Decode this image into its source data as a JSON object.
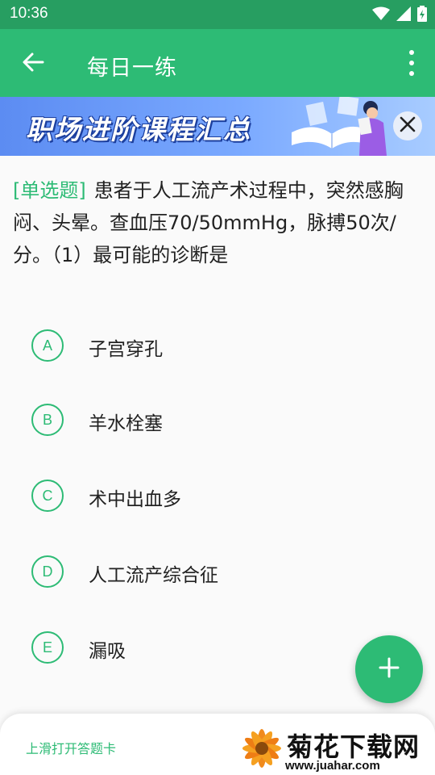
{
  "status_bar": {
    "time": "10:36"
  },
  "app_bar": {
    "title": "每日一练"
  },
  "banner": {
    "text": "职场进阶课程汇总"
  },
  "question": {
    "type_label": "[单选题]",
    "text": "患者于人工流产术过程中，突然感胸闷、头晕。查血压70/50mmHg，脉搏50次/分。（1）最可能的诊断是"
  },
  "options": [
    {
      "letter": "A",
      "text": "子宫穿孔"
    },
    {
      "letter": "B",
      "text": "羊水栓塞"
    },
    {
      "letter": "C",
      "text": "术中出血多"
    },
    {
      "letter": "D",
      "text": "人工流产综合征"
    },
    {
      "letter": "E",
      "text": "漏吸"
    }
  ],
  "bottom_sheet": {
    "hint": "上滑打开答题卡"
  },
  "watermark": {
    "title": "菊花下载网",
    "url": "www.juahar.com"
  },
  "colors": {
    "primary": "#2dbb75",
    "status_bar": "#279e61",
    "banner": "#6b9cf8"
  },
  "icons": {
    "back": "arrow-left-icon",
    "more": "more-vert-icon",
    "close": "close-icon",
    "fab": "plus-icon",
    "wifi": "wifi-icon",
    "signal": "signal-icon",
    "battery": "battery-icon"
  }
}
